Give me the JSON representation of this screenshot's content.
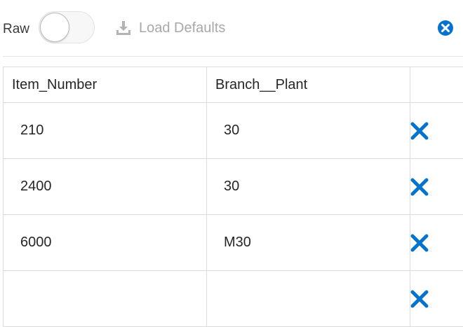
{
  "toolbar": {
    "raw_label": "Raw",
    "raw_toggle_on": false,
    "load_defaults_label": "Load Defaults"
  },
  "colors": {
    "accent": "#0572ce",
    "muted": "#a8a8a8"
  },
  "table": {
    "columns": [
      "Item_Number",
      "Branch__Plant",
      ""
    ],
    "rows": [
      {
        "item_number": "210",
        "branch_plant": "30"
      },
      {
        "item_number": "2400",
        "branch_plant": "30"
      },
      {
        "item_number": "6000",
        "branch_plant": "M30"
      },
      {
        "item_number": "",
        "branch_plant": ""
      }
    ]
  },
  "icons": {
    "load_defaults": "download-icon",
    "close_all": "close-circle-icon",
    "row_delete": "delete-x-icon"
  }
}
